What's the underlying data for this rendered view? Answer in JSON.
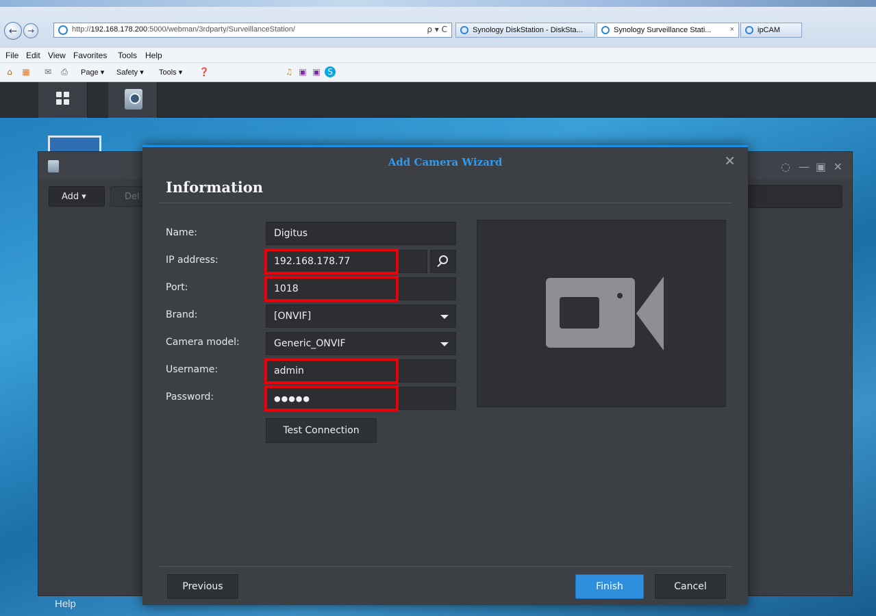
{
  "browser": {
    "address_prefix": "http://",
    "address_host": "192.168.178.200",
    "address_path": ":5000/webman/3rdparty/SurveillanceStation/",
    "address_tools": "ρ ▾ C",
    "tabs": [
      {
        "label": "Synology DiskStation - DiskSta..."
      },
      {
        "label": "Synology Surveillance Stati...",
        "close": "×"
      },
      {
        "label": "ipCAM"
      }
    ],
    "menu": [
      "File",
      "Edit",
      "View",
      "Favorites",
      "Tools",
      "Help"
    ],
    "commands": {
      "page": "Page ▾",
      "safety": "Safety ▾",
      "tools": "Tools ▾"
    }
  },
  "app": {
    "toolbar": {
      "add": "Add ▾",
      "delete": "Del"
    },
    "help": "Help"
  },
  "wizard": {
    "title": "Add Camera Wizard",
    "heading": "Information",
    "fields": [
      {
        "label": "Name:",
        "value": "Digitus"
      },
      {
        "label": "IP address:",
        "value": "192.168.178.77"
      },
      {
        "label": "Port:",
        "value": "1018"
      },
      {
        "label": "Brand:",
        "value": "[ONVIF]"
      },
      {
        "label": "Camera model:",
        "value": "Generic_ONVIF"
      },
      {
        "label": "Username:",
        "value": "admin"
      },
      {
        "label": "Password:",
        "value": "●●●●●"
      }
    ],
    "test_connection": "Test Connection",
    "previous": "Previous",
    "finish": "Finish",
    "cancel": "Cancel"
  },
  "colors": {
    "accent": "#2d8fdd",
    "highlight": "#e8000b",
    "panel": "#3c3f44"
  }
}
